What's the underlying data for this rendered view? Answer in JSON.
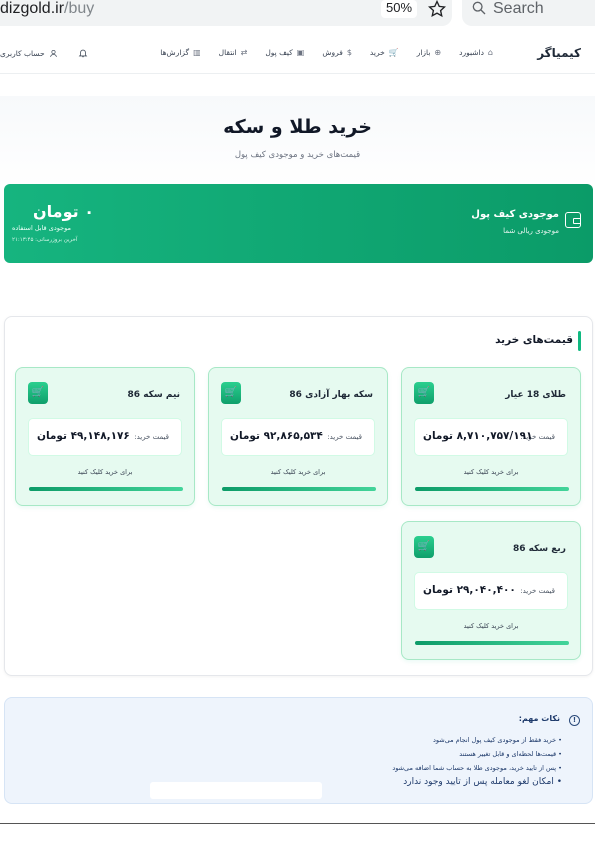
{
  "browser": {
    "url_host": "dizgold.ir",
    "url_path": "/buy",
    "zoom": "50%",
    "search_placeholder": "Search"
  },
  "nav": {
    "brand": "کیمیاگر",
    "items": [
      {
        "label": "داشبورد",
        "icon": "⌂"
      },
      {
        "label": "بازار",
        "icon": "⊕"
      },
      {
        "label": "خرید",
        "icon": "🛒"
      },
      {
        "label": "فروش",
        "icon": "$"
      },
      {
        "label": "کیف پول",
        "icon": "▣"
      },
      {
        "label": "انتقال",
        "icon": "⇄"
      },
      {
        "label": "گزارش‌ها",
        "icon": "▥"
      }
    ],
    "account_label": "حساب کاربری"
  },
  "hero": {
    "title": "خرید طلا و سکه",
    "subtitle": "قیمت‌های خرید و موجودی کیف پول"
  },
  "wallet": {
    "title": "موجودی کیف پول",
    "subtitle": "موجودی ریالی شما",
    "amount": "۰ تومان",
    "available_label": "موجودی قابل استفاده",
    "updated": "آخرین بروزرسانی: ۲۱:۱۳:۴۵"
  },
  "prices": {
    "title": "قیمت‌های خرید",
    "price_label": "قیمت خرید:",
    "hint": "برای خرید کلیک کنید",
    "cards": [
      {
        "name": "طلای 18 عیار",
        "price": "۸,۷۱۰,۷۵۷/۱۹۱ تومان"
      },
      {
        "name": "سکه بهار آزادی 86",
        "price": "۹۲,۸۶۵,۵۳۴ تومان"
      },
      {
        "name": "نیم سکه 86",
        "price": "۴۹,۱۴۸,۱۷۶ تومان"
      },
      {
        "name": "ربع سکه 86",
        "price": "۲۹,۰۴۰,۴۰۰ تومان"
      }
    ]
  },
  "notes": {
    "title": "نکات مهم:",
    "items": [
      "خرید فقط از موجودی کیف پول انجام می‌شود",
      "قیمت‌ها لحظه‌ای و قابل تغییر هستند",
      "پس از تایید خرید، موجودی طلا به حساب شما اضافه می‌شود",
      "امکان لغو معامله  پس از تایید وجود ندارد"
    ]
  },
  "colors": {
    "accent": "#10b981",
    "wallet_start": "#16b47f",
    "wallet_end": "#0b9b68",
    "card_bg": "#e6faf0",
    "notes_bg": "#eef4fc"
  }
}
